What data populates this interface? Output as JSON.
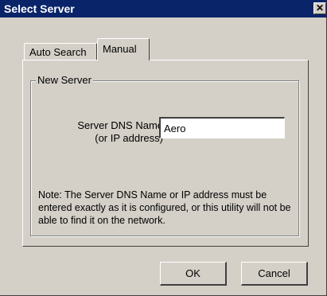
{
  "window": {
    "title": "Select Server",
    "close_glyph": "✕"
  },
  "tabs": [
    {
      "label": "Auto Search",
      "active": false
    },
    {
      "label": "Manual",
      "active": true
    }
  ],
  "group": {
    "legend": "New Server"
  },
  "field": {
    "label_line1": "Server DNS Name",
    "label_line2": "(or IP address)",
    "value": "Aero"
  },
  "note": "Note: The Server DNS Name or IP address must be entered exactly as it is configured, or this utility will not be able to find it on the network.",
  "buttons": {
    "ok": "OK",
    "cancel": "Cancel"
  },
  "colors": {
    "titlebar": "#0a246a",
    "face": "#d4d0c8"
  }
}
